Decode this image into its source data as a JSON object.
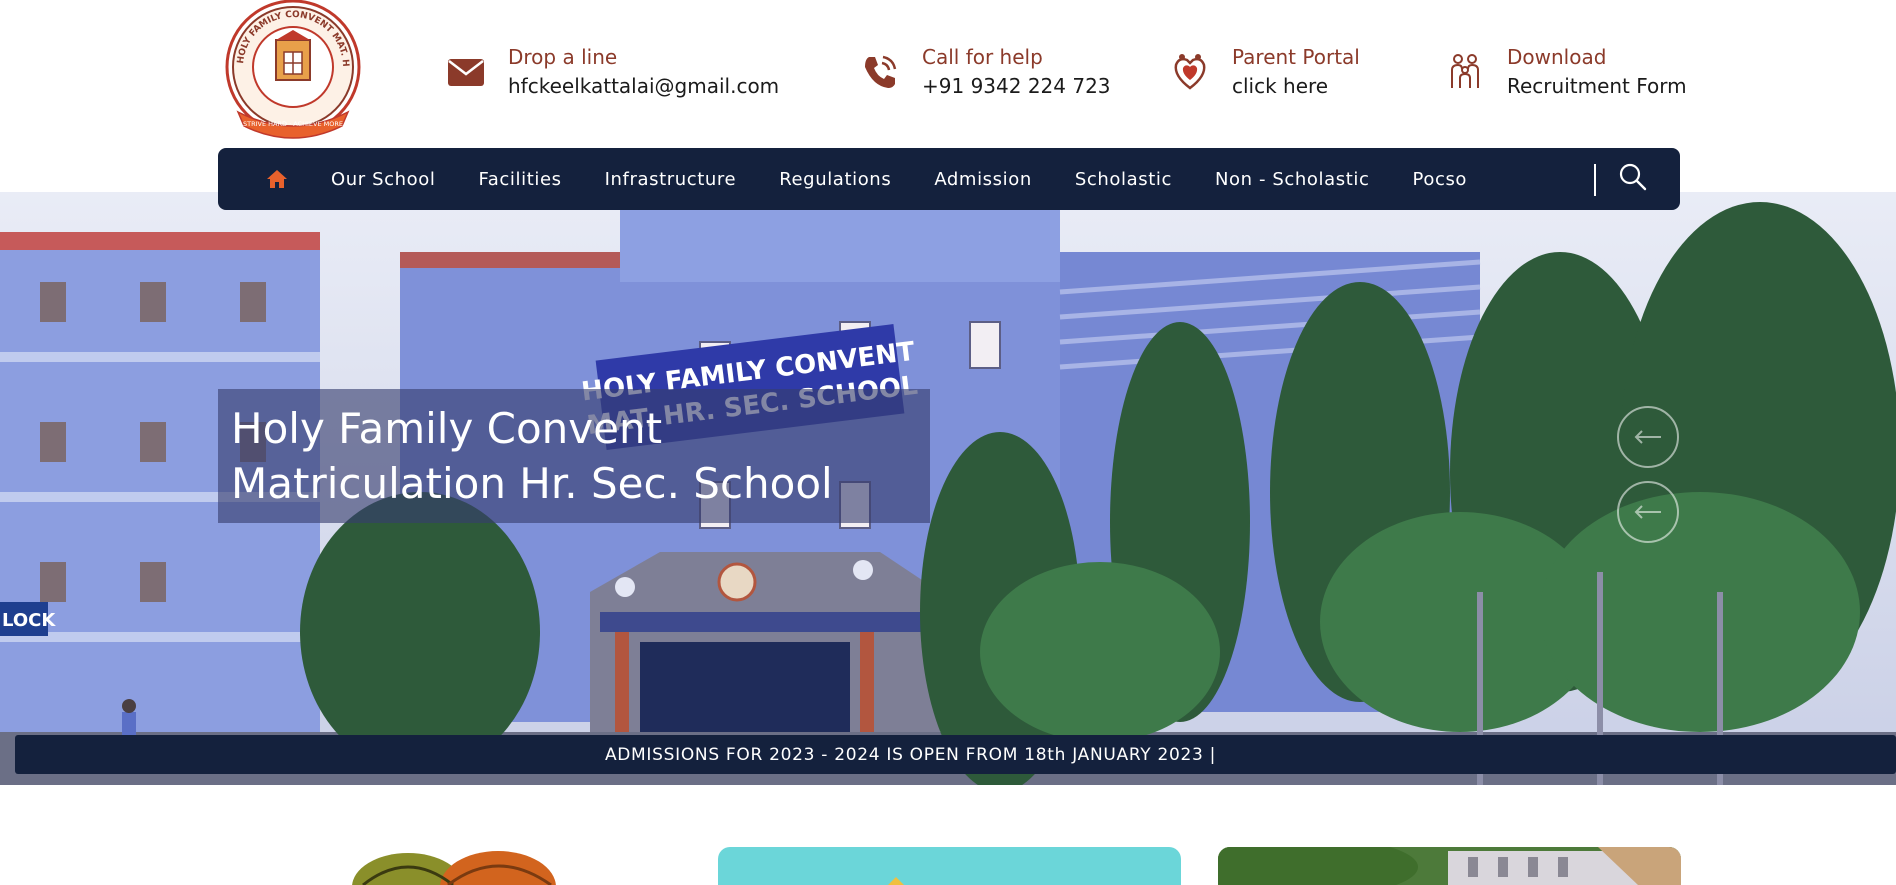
{
  "school": {
    "logo_text": "HOLY FAMILY CONVENT MAT. HR. SEC. SCHOOL",
    "logo_motto": "STRIVE HARD · ACHIEVE MORE"
  },
  "contacts": [
    {
      "icon": "envelope-icon",
      "label": "Drop a line",
      "value": "hfckeelkattalai@gmail.com"
    },
    {
      "icon": "phone-icon",
      "label": "Call for help",
      "value": "+91 9342 224 723"
    },
    {
      "icon": "parent-hearts-icon",
      "label": "Parent Portal",
      "value": "click here"
    },
    {
      "icon": "family-group-icon",
      "label": "Download",
      "value": "Recruitment Form"
    }
  ],
  "nav": {
    "home_icon": "home-icon",
    "items": [
      "Our School",
      "Facilities",
      "Infrastructure",
      "Regulations",
      "Admission",
      "Scholastic",
      "Non - Scholastic",
      "Pocso"
    ],
    "search_icon": "search-icon"
  },
  "hero": {
    "title_line1": "Holy Family Convent",
    "title_line2": "Matriculation Hr. Sec. School",
    "building_sign_line1": "HOLY FAMILY CONVENT",
    "building_sign_line2": "MAT. HR. SEC. SCHOOL",
    "block_sign": "LOCK"
  },
  "ticker": {
    "text": "ADMISSIONS FOR 2023 - 2024 IS OPEN FROM 18th JANUARY 2023 |"
  },
  "colors": {
    "navy": "#14213d",
    "brand_brown": "#8b3a2a",
    "accent_orange": "#e8612c",
    "teal_card": "#6bd6d9"
  }
}
